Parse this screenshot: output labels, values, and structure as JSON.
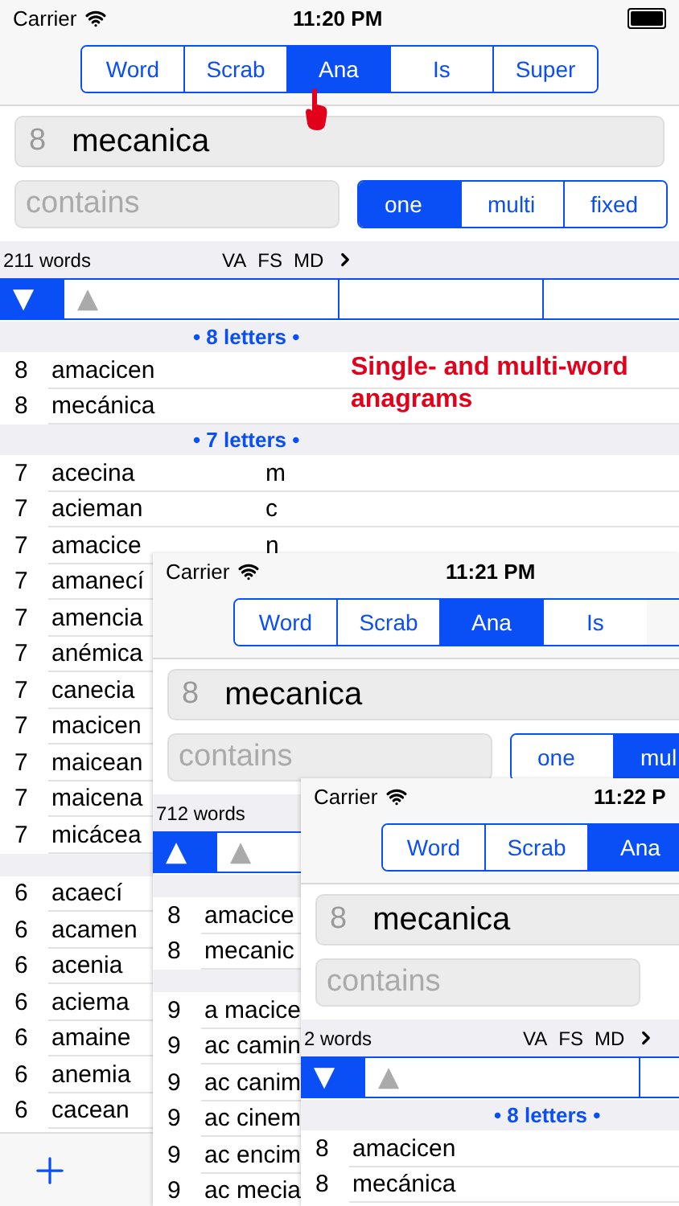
{
  "annotation": "Single- and multi-word anagrams",
  "screens": [
    {
      "status": {
        "carrier": "Carrier",
        "time": "11:20 PM"
      },
      "tabs": [
        {
          "label": "Word",
          "selected": false
        },
        {
          "label": "Scrab",
          "selected": false
        },
        {
          "label": "Ana",
          "selected": true
        },
        {
          "label": "Is",
          "selected": false
        },
        {
          "label": "Super",
          "selected": false
        }
      ],
      "search": {
        "length": "8",
        "value": "mecanica"
      },
      "contains": {
        "placeholder": "contains"
      },
      "modes": [
        {
          "label": "one",
          "selected": true
        },
        {
          "label": "multi",
          "selected": false
        },
        {
          "label": "fixed",
          "selected": false
        }
      ],
      "count": "211 words",
      "flags": [
        "VA",
        "FS",
        "MD"
      ],
      "sort": [
        {
          "symbol": "▼",
          "selected": true
        },
        {
          "symbol": "▲",
          "selected": false
        }
      ],
      "sections": [
        {
          "title": "• 8 letters •",
          "rows": [
            {
              "length": "8",
              "word": "amacicen"
            },
            {
              "length": "8",
              "word": "mecánica"
            }
          ]
        },
        {
          "title": "• 7 letters •",
          "rows": [
            {
              "length": "7",
              "word": "acecina",
              "extra": "m"
            },
            {
              "length": "7",
              "word": "acieman",
              "extra": "c"
            },
            {
              "length": "7",
              "word": "amacice",
              "extra": "n"
            },
            {
              "length": "7",
              "word": "amanecí"
            },
            {
              "length": "7",
              "word": "amencia"
            },
            {
              "length": "7",
              "word": "anémica"
            },
            {
              "length": "7",
              "word": "canecia"
            },
            {
              "length": "7",
              "word": "macicen"
            },
            {
              "length": "7",
              "word": "maicean"
            },
            {
              "length": "7",
              "word": "maicena"
            },
            {
              "length": "7",
              "word": "micácea"
            }
          ]
        },
        {
          "rows": [
            {
              "length": "6",
              "word": "acaecí"
            },
            {
              "length": "6",
              "word": "acamen"
            },
            {
              "length": "6",
              "word": "acenia"
            },
            {
              "length": "6",
              "word": "aciema"
            },
            {
              "length": "6",
              "word": "amaine"
            },
            {
              "length": "6",
              "word": "anemia"
            },
            {
              "length": "6",
              "word": "cacean"
            }
          ]
        }
      ],
      "toolbar": true
    },
    {
      "status": {
        "carrier": "Carrier",
        "time": "11:21 PM"
      },
      "tabs": [
        {
          "label": "Word",
          "selected": false
        },
        {
          "label": "Scrab",
          "selected": false
        },
        {
          "label": "Ana",
          "selected": true
        },
        {
          "label": "Is",
          "selected": false
        }
      ],
      "search": {
        "length": "8",
        "value": "mecanica"
      },
      "contains": {
        "placeholder": "contains"
      },
      "modes": [
        {
          "label": "one",
          "selected": false
        },
        {
          "label": "mul",
          "selected": true
        }
      ],
      "count": "712 words",
      "sort": [
        {
          "symbol": "▲",
          "selected": true
        },
        {
          "symbol": "▲",
          "selected": false
        }
      ],
      "sections": [
        {
          "rows": [
            {
              "length": "8",
              "word": "amacice"
            },
            {
              "length": "8",
              "word": "mecanic"
            }
          ]
        },
        {
          "rows": [
            {
              "length": "9",
              "word": "a macice"
            },
            {
              "length": "9",
              "word": "ac camin"
            },
            {
              "length": "9",
              "word": "ac canim"
            },
            {
              "length": "9",
              "word": "ac cinem"
            },
            {
              "length": "9",
              "word": "ac encim"
            },
            {
              "length": "9",
              "word": "ac mecia"
            }
          ]
        }
      ]
    },
    {
      "status": {
        "carrier": "Carrier",
        "time": "11:22 P"
      },
      "tabs": [
        {
          "label": "Word",
          "selected": false
        },
        {
          "label": "Scrab",
          "selected": false
        },
        {
          "label": "Ana",
          "selected": true
        }
      ],
      "search": {
        "length": "8",
        "value": "mecanica"
      },
      "contains": {
        "placeholder": "contains"
      },
      "count": "2 words",
      "flags": [
        "VA",
        "FS",
        "MD"
      ],
      "sort": [
        {
          "symbol": "▼",
          "selected": true
        },
        {
          "symbol": "▲",
          "selected": false
        }
      ],
      "sections": [
        {
          "title": "• 8 letters •",
          "rows": [
            {
              "length": "8",
              "word": "amacicen"
            },
            {
              "length": "8",
              "word": "mecánica"
            }
          ]
        }
      ]
    }
  ]
}
